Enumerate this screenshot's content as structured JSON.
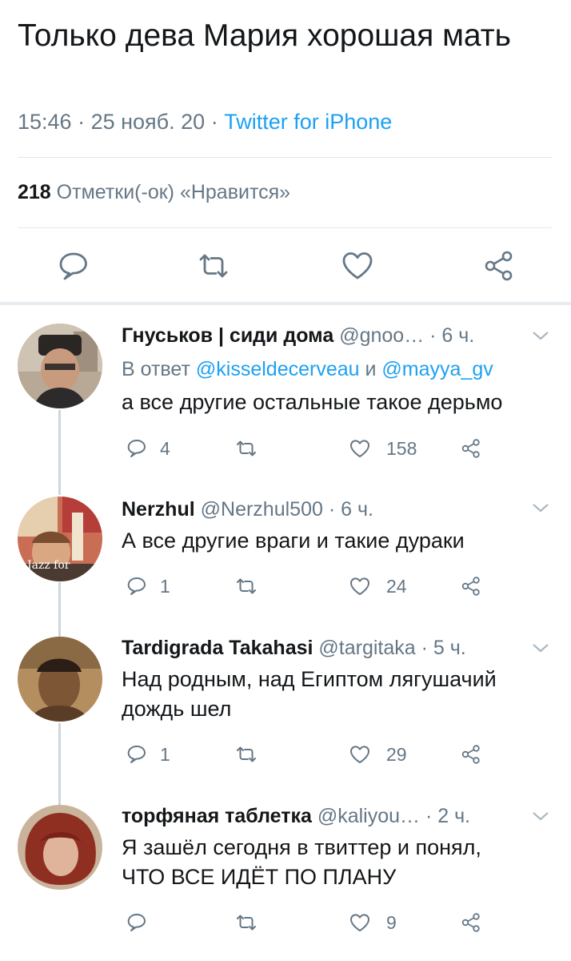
{
  "tweet": {
    "text": "Только дева Мария хорошая мать",
    "time": "15:46",
    "date": "25 нояб. 20",
    "source": "Twitter for iPhone",
    "likes_count": "218",
    "likes_label": "Отметки(-ок) «Нравится»"
  },
  "replies": [
    {
      "name": "Гнуськов | сиди дома",
      "handle": "@gnoo…",
      "time": "· 6 ч.",
      "reply_to_prefix": "В ответ",
      "mention1": "@kisseldecerveau",
      "and": "и",
      "mention2": "@mayya_gv",
      "text": "а все другие остальные такое дерьмо",
      "replies": "4",
      "retweets": "",
      "likes": "158"
    },
    {
      "name": "Nerzhul",
      "handle": "@Nerzhul500",
      "time": "· 6 ч.",
      "avatar_text": "Jazz for",
      "text": "А все другие враги и такие дураки",
      "replies": "1",
      "retweets": "",
      "likes": "24"
    },
    {
      "name": "Tardigrada Takahasi",
      "handle": "@targitaka",
      "time": "· 5 ч.",
      "text_line1": "Над родным, над Египтом лягушачий",
      "text_line2": "дождь шел",
      "replies": "1",
      "retweets": "",
      "likes": "29"
    },
    {
      "name": "торфяная таблетка",
      "handle": "@kaliyou…",
      "time": "· 2 ч.",
      "text_line1": "Я зашёл сегодня в твиттер и понял,",
      "text_line2": "ЧТО ВСЕ ИДЁТ ПО ПЛАНУ",
      "replies": "",
      "retweets": "",
      "likes": "9"
    }
  ],
  "colors": {
    "accent": "#1da1f2",
    "secondary_text": "#657786",
    "primary_text": "#14171a",
    "divider": "#e1e8ed"
  },
  "icons": [
    "reply-icon",
    "retweet-icon",
    "like-icon",
    "share-icon",
    "chevron-down-icon"
  ]
}
